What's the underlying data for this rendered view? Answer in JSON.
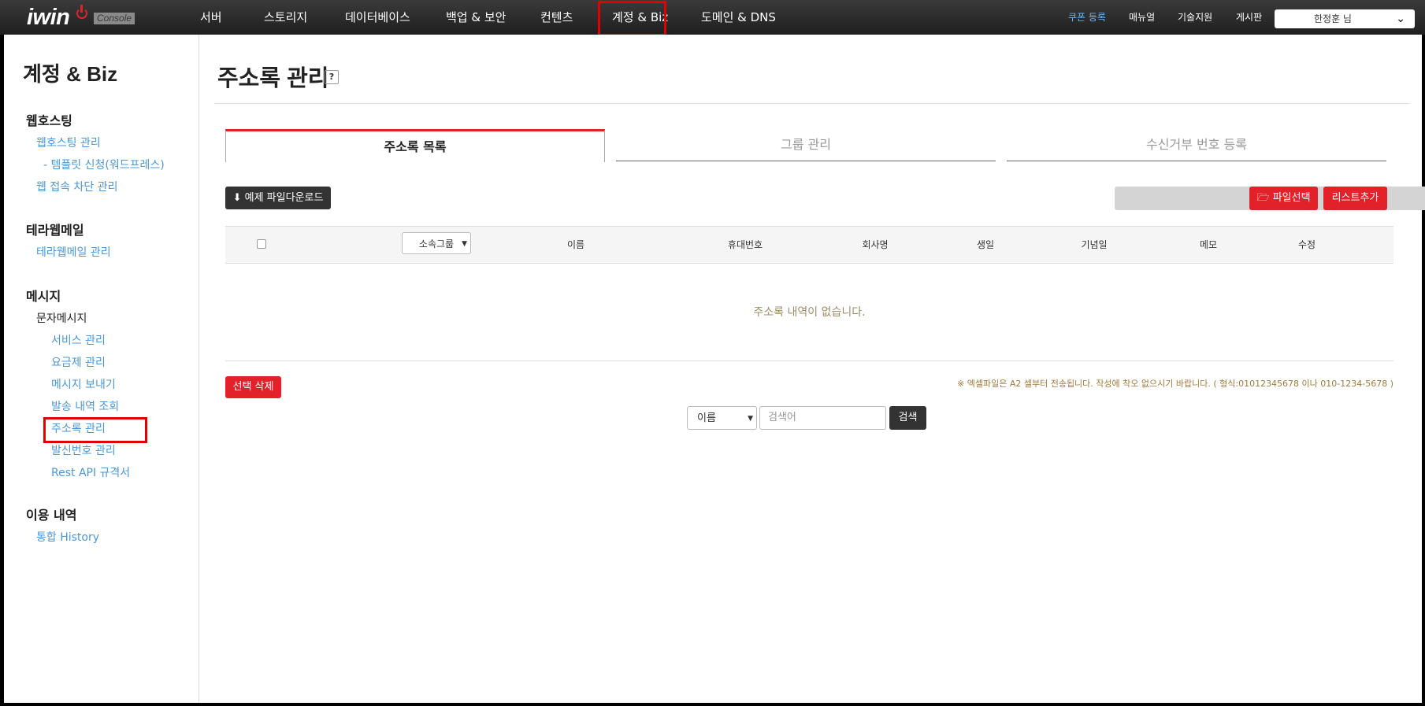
{
  "brand": {
    "logo": "iwin",
    "badge": "Console"
  },
  "nav": {
    "items": [
      "서버",
      "스토리지",
      "데이터베이스",
      "백업 & 보안",
      "컨텐츠",
      "계정 & Biz",
      "도메인 & DNS"
    ],
    "active": "계정 & Biz"
  },
  "top_links": {
    "coupon": "쿠폰 등록",
    "manual": "매뉴얼",
    "support": "기술지원",
    "board": "게시판"
  },
  "user": {
    "name": "한정훈 님"
  },
  "sidebar": {
    "title": "계정 & Biz",
    "hosting": {
      "heading": "웹호스팅",
      "manage": "웹호스팅 관리",
      "template": "- 템플릿 신청(워드프레스)",
      "block": "웹 접속 차단 관리"
    },
    "terramail": {
      "heading": "테라웹메일",
      "manage": "테라웹메일 관리"
    },
    "message": {
      "heading": "메시지",
      "sub": "문자메시지",
      "items": [
        "서비스 관리",
        "요금제 관리",
        "메시지 보내기",
        "발송 내역 조회",
        "주소록 관리",
        "발신번호 관리",
        "Rest API 규격서"
      ],
      "active": "주소록 관리"
    },
    "usage": {
      "heading": "이용 내역",
      "history": "통합 History"
    }
  },
  "main": {
    "title": "주소록 관리",
    "help": "?",
    "tabs": [
      "주소록 목록",
      "그룹 관리",
      "수신거부 번호 등록"
    ],
    "download_btn": "예제 파일다운로드",
    "file_btn": "파일선택",
    "list_add_btn": "리스트추가",
    "group_select": "소속그룹",
    "columns": [
      "이름",
      "휴대번호",
      "회사명",
      "생일",
      "기념일",
      "메모",
      "수정"
    ],
    "empty": "주소록 내역이 없습니다.",
    "delete_btn": "선택 삭제",
    "note": "※ 엑셀파일은 A2 셀부터 전송됩니다. 작성에 착오 없으시기 바랍니다. ( 형식:01012345678 이나 010-1234-5678 )",
    "search": {
      "field": "이름",
      "placeholder": "검색어",
      "button": "검색"
    }
  },
  "colors": {
    "accent": "#e22228",
    "link": "#4a97d8",
    "topbar": "#2b2b2b",
    "highlight": "#e20000"
  }
}
